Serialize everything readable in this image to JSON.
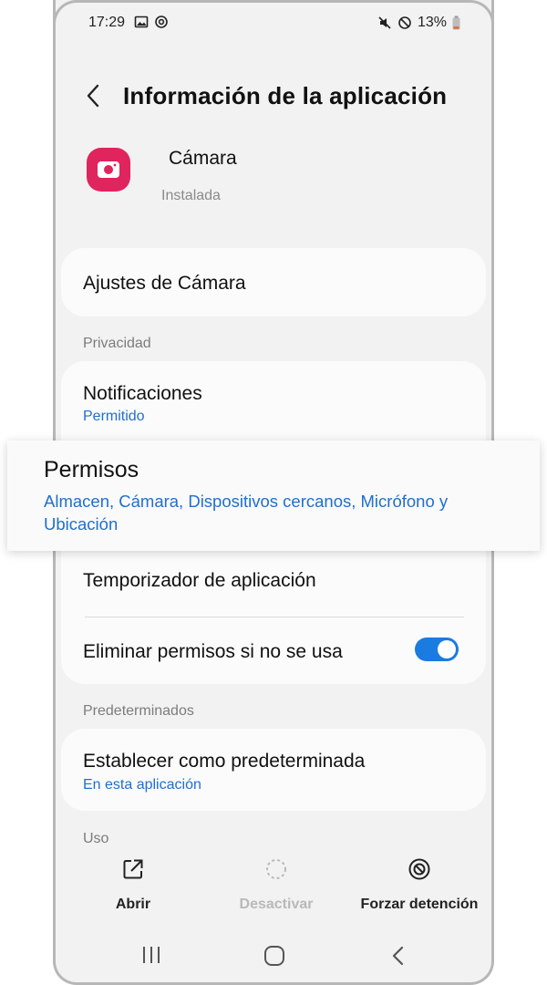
{
  "status_bar": {
    "time": "17:29",
    "battery": "13%"
  },
  "header": {
    "title": "Información de la aplicación"
  },
  "app": {
    "name": "Cámara",
    "state": "Instalada",
    "icon_color": "#e0245e"
  },
  "settings": {
    "app_settings_label": "Ajustes de Cámara"
  },
  "privacy": {
    "section_label": "Privacidad",
    "notifications_label": "Notificaciones",
    "notifications_value": "Permitido",
    "permissions_label": "Permisos",
    "permissions_value": "Almacen, Cámara, Dispositivos cercanos, Micrófono y Ubicación",
    "timer_label": "Temporizador de aplicación",
    "remove_permissions_label": "Eliminar permisos si no se usa",
    "remove_permissions_enabled": true
  },
  "defaults": {
    "section_label": "Predeterminados",
    "set_default_label": "Establecer como predeterminada",
    "set_default_value": "En esta aplicación"
  },
  "usage": {
    "section_label": "Uso"
  },
  "bottom_actions": [
    {
      "label": "Abrir",
      "icon": "open-external-icon",
      "enabled": true
    },
    {
      "label": "Desactivar",
      "icon": "disable-dashed-circle-icon",
      "enabled": false
    },
    {
      "label": "Forzar detención",
      "icon": "force-stop-icon",
      "enabled": true
    }
  ],
  "colors": {
    "accent": "#1a7be0",
    "link": "#1f6fd0",
    "background": "#f2f2f2"
  }
}
